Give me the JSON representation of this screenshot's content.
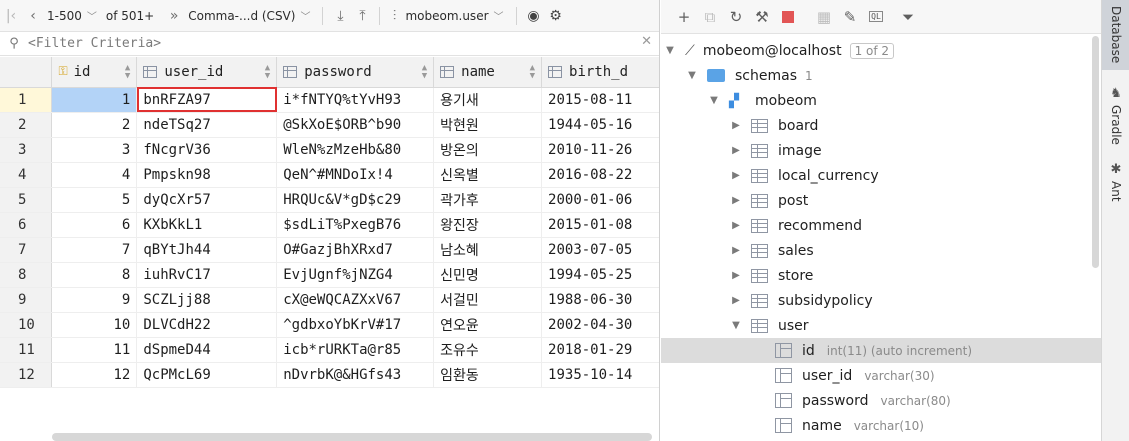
{
  "toolbar": {
    "range": "1-500",
    "of_total": "of 501+",
    "file_format": "Comma-...d (CSV)",
    "target": "mobeom.user"
  },
  "filter": {
    "placeholder": "<Filter Criteria>"
  },
  "grid": {
    "columns": [
      "id",
      "user_id",
      "password",
      "name",
      "birth_d"
    ],
    "rows": [
      {
        "n": "1",
        "id": "1",
        "user_id": "bnRFZA97",
        "password": "i*fNTYQ%tYvH93",
        "name": "용기새",
        "birth": "2015-08-11"
      },
      {
        "n": "2",
        "id": "2",
        "user_id": "ndeTSq27",
        "password": "@SkXoE$ORB^b90",
        "name": "박현원",
        "birth": "1944-05-16"
      },
      {
        "n": "3",
        "id": "3",
        "user_id": "fNcgrV36",
        "password": "WleN%zMzeHb&80",
        "name": "방온의",
        "birth": "2010-11-26"
      },
      {
        "n": "4",
        "id": "4",
        "user_id": "Pmpskn98",
        "password": "QeN^#MNDoIx!4",
        "name": "신옥별",
        "birth": "2016-08-22"
      },
      {
        "n": "5",
        "id": "5",
        "user_id": "dyQcXr57",
        "password": "HRQUc&V*gD$c29",
        "name": "곽가후",
        "birth": "2000-01-06"
      },
      {
        "n": "6",
        "id": "6",
        "user_id": "KXbKkL1",
        "password": "$sdLiT%PxegB76",
        "name": "왕진장",
        "birth": "2015-01-08"
      },
      {
        "n": "7",
        "id": "7",
        "user_id": "qBYtJh44",
        "password": "O#GazjBhXRxd7",
        "name": "남소혜",
        "birth": "2003-07-05"
      },
      {
        "n": "8",
        "id": "8",
        "user_id": "iuhRvC17",
        "password": "EvjUgnf%jNZG4",
        "name": "신민명",
        "birth": "1994-05-25"
      },
      {
        "n": "9",
        "id": "9",
        "user_id": "SCZLjj88",
        "password": "cX@eWQCAZXxV67",
        "name": "서걸민",
        "birth": "1988-06-30"
      },
      {
        "n": "10",
        "id": "10",
        "user_id": "DLVCdH22",
        "password": "^gdbxoYbKrV#17",
        "name": "연오윤",
        "birth": "2002-04-30"
      },
      {
        "n": "11",
        "id": "11",
        "user_id": "dSpmeD44",
        "password": "icb*rURKTa@r85",
        "name": "조유수",
        "birth": "2018-01-29"
      },
      {
        "n": "12",
        "id": "12",
        "user_id": "QcPMcL69",
        "password": "nDvrbK@&HGfs43",
        "name": "임환동",
        "birth": "1935-10-14"
      }
    ]
  },
  "tree": {
    "connection": "mobeom@localhost",
    "conn_badge": "1 of 2",
    "schemas_label": "schemas",
    "schemas_count": "1",
    "schema": "mobeom",
    "tables": [
      "board",
      "image",
      "local_currency",
      "post",
      "recommend",
      "sales",
      "store",
      "subsidypolicy",
      "user"
    ],
    "columns": [
      {
        "name": "id",
        "type": "int(11) (auto increment)"
      },
      {
        "name": "user_id",
        "type": "varchar(30)"
      },
      {
        "name": "password",
        "type": "varchar(80)"
      },
      {
        "name": "name",
        "type": "varchar(10)"
      }
    ]
  },
  "side_tabs": [
    "Database",
    "Gradle",
    "Ant"
  ],
  "colors": {
    "selection_red": "#e03131",
    "id_cell_blue": "#b3d3f7",
    "folder_blue": "#5aa3e6"
  }
}
